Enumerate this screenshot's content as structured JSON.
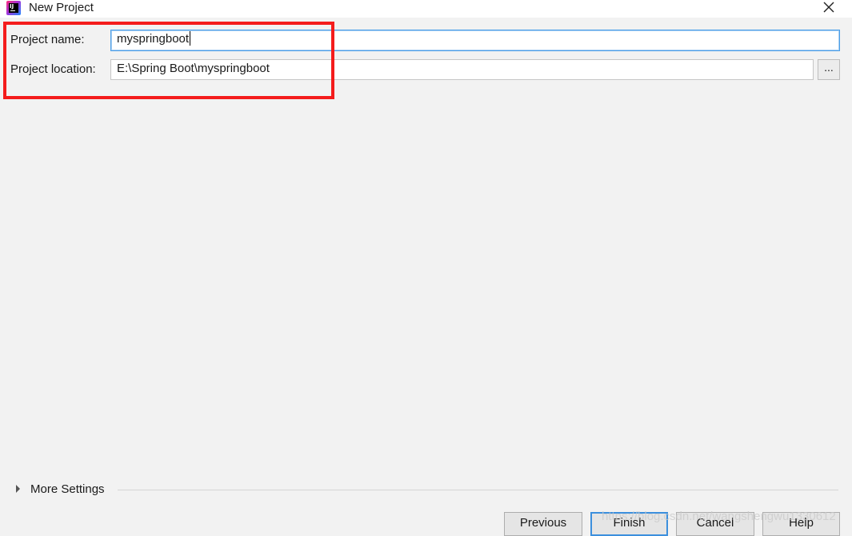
{
  "window": {
    "title": "New Project",
    "app_icon": "intellij-icon",
    "close_icon": "close-icon"
  },
  "form": {
    "name_label": "Project name:",
    "name_value": "myspringboot",
    "location_label": "Project location:",
    "location_value": "E:\\Spring Boot\\myspringboot",
    "browse_label": "..."
  },
  "more_settings": {
    "label": "More Settings",
    "expanded": false
  },
  "buttons": {
    "previous": "Previous",
    "finish": "Finish",
    "cancel": "Cancel",
    "help": "Help"
  },
  "watermark": "https://blog.csdn.net/wangshengwu1330612",
  "colors": {
    "highlight": "#f41c1c",
    "focus": "#4a9ee8",
    "background": "#f2f2f2"
  }
}
